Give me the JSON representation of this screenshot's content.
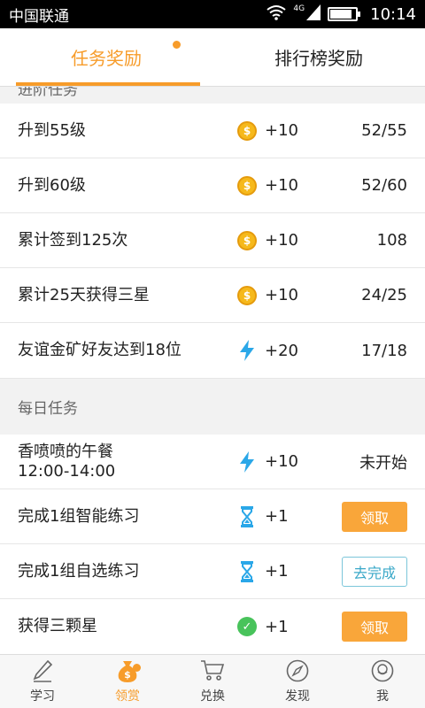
{
  "status_bar": {
    "carrier": "中国联通",
    "network": "4G",
    "time": "10:14",
    "battery_level": 0.85
  },
  "tabs": [
    {
      "label": "任务奖励",
      "active": true,
      "badge_dot": true
    },
    {
      "label": "排行榜奖励",
      "active": false
    }
  ],
  "partial_section_title": "进阶任务",
  "upgrade_tasks": [
    {
      "label": "升到55级",
      "reward_icon": "coin-icon",
      "reward": "+10",
      "status": "52/55"
    },
    {
      "label": "升到60级",
      "reward_icon": "coin-icon",
      "reward": "+10",
      "status": "52/60"
    },
    {
      "label": "累计签到125次",
      "reward_icon": "coin-icon",
      "reward": "+10",
      "status": "108"
    },
    {
      "label": "累计25天获得三星",
      "reward_icon": "coin-icon",
      "reward": "+10",
      "status": "24/25"
    },
    {
      "label": "友谊金矿好友达到18位",
      "reward_icon": "lightning-icon",
      "reward": "+20",
      "status": "17/18"
    }
  ],
  "daily_section_title": "每日任务",
  "daily_tasks": [
    {
      "label": "香喷喷的午餐",
      "sublabel": "12:00-14:00",
      "reward_icon": "lightning-icon",
      "reward": "+10",
      "status": "未开始"
    },
    {
      "label": "完成1组智能练习",
      "reward_icon": "hourglass-icon",
      "reward": "+1",
      "button": "领取"
    },
    {
      "label": "完成1组自选练习",
      "reward_icon": "hourglass-icon",
      "reward": "+1",
      "button": "去完成"
    },
    {
      "label": "获得三颗星",
      "reward_icon": "check-circle-icon",
      "reward": "+1",
      "button": "领取"
    }
  ],
  "bottom_nav": [
    {
      "label": "学习",
      "icon": "pencil-icon",
      "active": false
    },
    {
      "label": "领赏",
      "icon": "money-bag-icon",
      "active": true,
      "badge_dot": true
    },
    {
      "label": "兑换",
      "icon": "cart-icon",
      "active": false
    },
    {
      "label": "发现",
      "icon": "compass-icon",
      "active": false
    },
    {
      "label": "我",
      "icon": "smiley-icon",
      "active": false
    }
  ],
  "colors": {
    "accent": "#f79c2a",
    "coin": "#f6b91b",
    "lightning": "#2aa7e8",
    "check": "#48c35b",
    "outline_button": "#3aa8c8"
  },
  "coin_symbol": "$",
  "check_symbol": "✓"
}
